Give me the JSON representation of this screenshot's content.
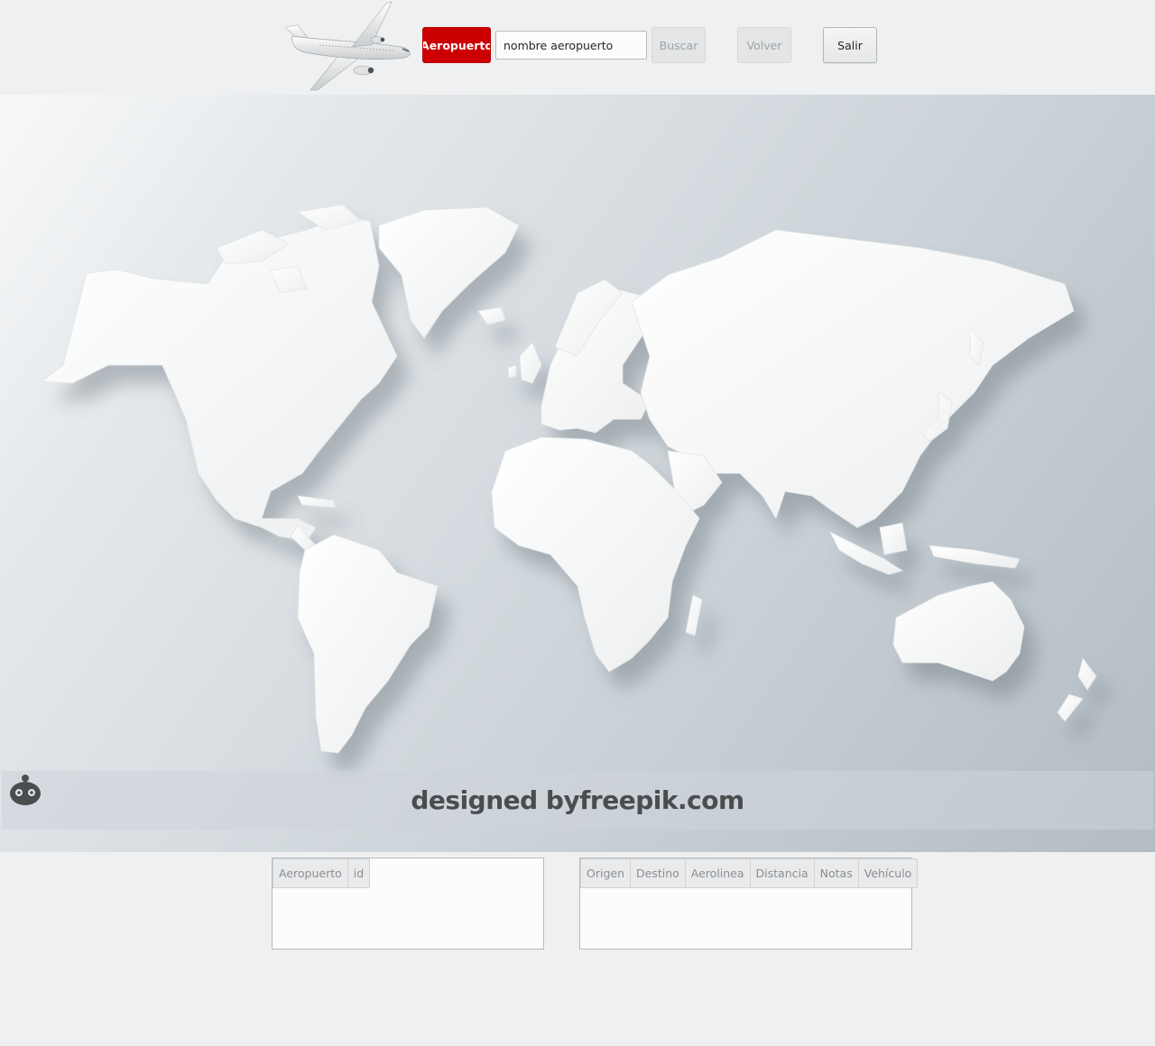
{
  "toolbar": {
    "airport_button": "Aeropuerto",
    "search_value": "nombre aeropuerto",
    "search_button": "Buscar",
    "back_button": "Volver",
    "exit_button": "Salir"
  },
  "map": {
    "credit_prefix": "designed by",
    "credit_suffix": "freepik.com"
  },
  "airport_table": {
    "columns": [
      "Aeropuerto",
      "id"
    ],
    "rows": []
  },
  "routes_table": {
    "columns": [
      "Origen",
      "Destino",
      "Aerolinea",
      "Distancia",
      "Notas",
      "Vehículo"
    ],
    "rows": []
  },
  "colors": {
    "accent": "#cc0000",
    "background": "#eff0f1"
  }
}
